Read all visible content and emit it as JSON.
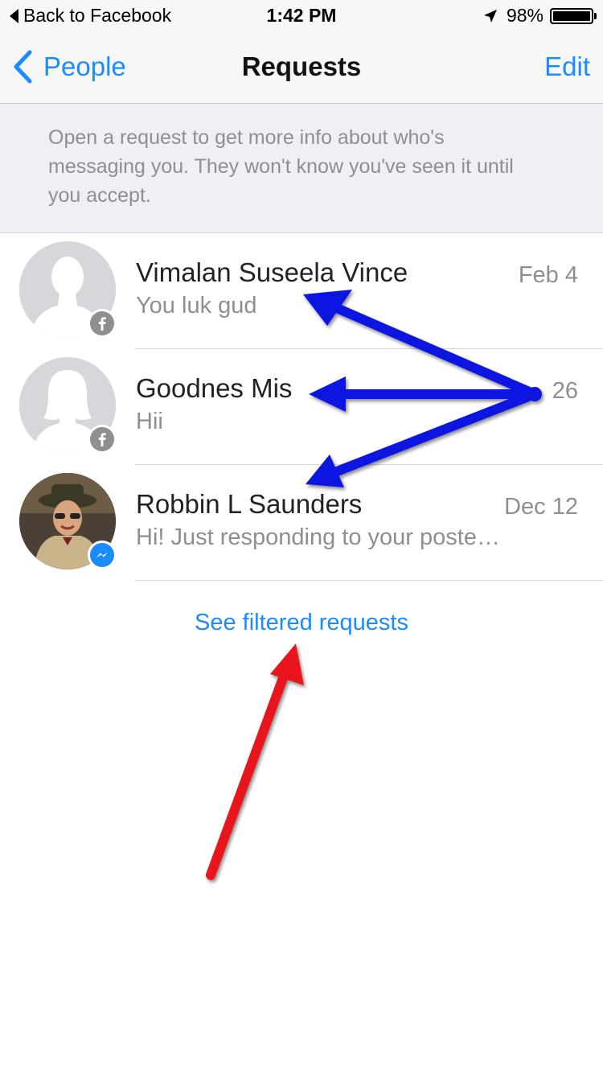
{
  "status_bar": {
    "back_label": "Back to Facebook",
    "time": "1:42 PM",
    "battery": "98%"
  },
  "nav": {
    "back_label": "People",
    "title": "Requests",
    "edit_label": "Edit"
  },
  "info": {
    "text": "Open a request to get more info about who's messaging you. They won't know you've seen it until you accept."
  },
  "requests": [
    {
      "name": "Vimalan Suseela Vince",
      "message": "You luk gud",
      "date": "Feb 4",
      "badge": "facebook-icon",
      "avatar": "silhouette-male"
    },
    {
      "name": "Goodnes Mis",
      "message": "Hii",
      "date": "26",
      "badge": "facebook-icon",
      "avatar": "silhouette-female"
    },
    {
      "name": "Robbin L Saunders",
      "message": "Hi!  Just responding to your poste…",
      "date": "Dec 12",
      "badge": "messenger-icon",
      "avatar": "photo"
    }
  ],
  "filtered_link": "See filtered requests",
  "colors": {
    "accent": "#1a8cff",
    "annotation_blue": "#0a18e0",
    "annotation_red": "#e8191e"
  }
}
